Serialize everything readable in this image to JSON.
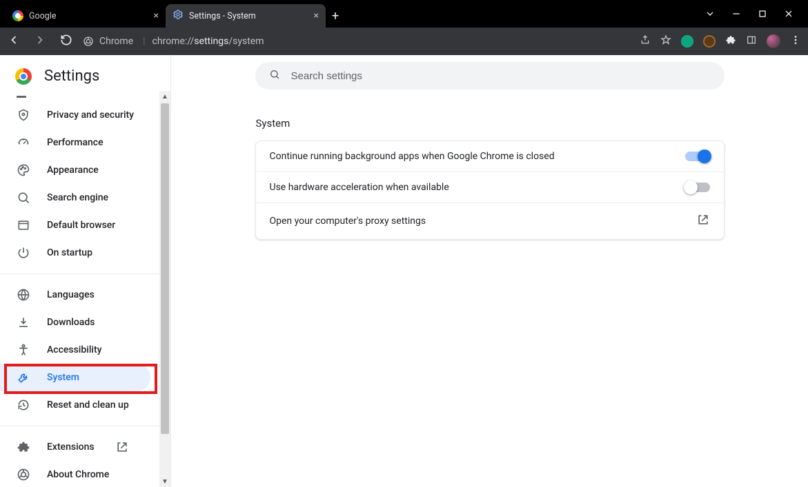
{
  "window": {
    "tabs": [
      {
        "title": "Google",
        "active": false
      },
      {
        "title": "Settings - System",
        "active": true
      }
    ]
  },
  "toolbar": {
    "chrome_label": "Chrome",
    "url_prefix": "chrome://",
    "url_strong": "settings",
    "url_suffix": "/system"
  },
  "sidebar": {
    "title": "Settings",
    "groups": [
      {
        "items": [
          {
            "id": "privacy",
            "label": "Privacy and security",
            "icon": "shield-icon"
          },
          {
            "id": "performance",
            "label": "Performance",
            "icon": "speedometer-icon"
          },
          {
            "id": "appearance",
            "label": "Appearance",
            "icon": "palette-icon"
          },
          {
            "id": "search-engine",
            "label": "Search engine",
            "icon": "magnifier-icon"
          },
          {
            "id": "default-browser",
            "label": "Default browser",
            "icon": "browser-icon"
          },
          {
            "id": "on-startup",
            "label": "On startup",
            "icon": "power-icon"
          }
        ]
      },
      {
        "items": [
          {
            "id": "languages",
            "label": "Languages",
            "icon": "globe-icon"
          },
          {
            "id": "downloads",
            "label": "Downloads",
            "icon": "download-icon"
          },
          {
            "id": "accessibility",
            "label": "Accessibility",
            "icon": "accessibility-icon"
          },
          {
            "id": "system",
            "label": "System",
            "icon": "wrench-icon",
            "active": true
          },
          {
            "id": "reset",
            "label": "Reset and clean up",
            "icon": "restore-icon"
          }
        ]
      },
      {
        "items": [
          {
            "id": "extensions",
            "label": "Extensions",
            "icon": "puzzle-icon",
            "external": true
          },
          {
            "id": "about",
            "label": "About Chrome",
            "icon": "chrome-outline-icon"
          }
        ]
      }
    ]
  },
  "main": {
    "search_placeholder": "Search settings",
    "section_title": "System",
    "rows": [
      {
        "id": "bgapps",
        "label": "Continue running background apps when Google Chrome is closed",
        "type": "toggle",
        "value": true
      },
      {
        "id": "hwaccel",
        "label": "Use hardware acceleration when available",
        "type": "toggle",
        "value": false
      },
      {
        "id": "proxy",
        "label": "Open your computer's proxy settings",
        "type": "link"
      }
    ]
  }
}
